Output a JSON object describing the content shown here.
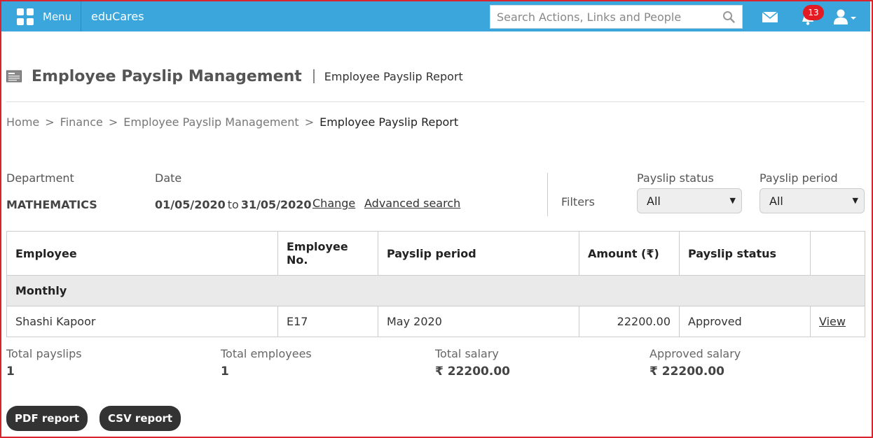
{
  "topbar": {
    "menu_label": "Menu",
    "brand": "eduCares",
    "search_placeholder": "Search Actions, Links and People",
    "notification_count": "13",
    "accent_color": "#3aa6dc"
  },
  "header": {
    "title": "Employee Payslip Management",
    "subtitle": "Employee Payslip Report"
  },
  "breadcrumb": {
    "items": [
      "Home",
      "Finance",
      "Employee Payslip Management"
    ],
    "current": "Employee Payslip Report",
    "separator": ">"
  },
  "criteria": {
    "department_label": "Department",
    "department_value": "MATHEMATICS",
    "date_label": "Date",
    "date_from": "01/05/2020",
    "date_to_word": "to",
    "date_to": "31/05/2020",
    "change_link": "Change",
    "advanced_link": "Advanced search"
  },
  "filters": {
    "label": "Filters",
    "payslip_status_label": "Payslip status",
    "payslip_status_value": "All",
    "payslip_period_label": "Payslip period",
    "payslip_period_value": "All"
  },
  "table": {
    "columns": [
      "Employee",
      "Employee No.",
      "Payslip period",
      "Amount (₹)",
      "Payslip status",
      ""
    ],
    "group": "Monthly",
    "rows": [
      {
        "employee": "Shashi Kapoor",
        "employee_no": "E17",
        "period": "May 2020",
        "amount": "22200.00",
        "status": "Approved",
        "action": "View"
      }
    ]
  },
  "summary": {
    "total_payslips_label": "Total payslips",
    "total_payslips": "1",
    "total_employees_label": "Total employees",
    "total_employees": "1",
    "total_salary_label": "Total salary",
    "total_salary": "₹ 22200.00",
    "approved_salary_label": "Approved salary",
    "approved_salary": "₹ 22200.00"
  },
  "actions": {
    "pdf_label": "PDF report",
    "csv_label": "CSV report"
  },
  "icons": [
    "grid-menu-icon",
    "search-icon",
    "mail-icon",
    "bell-icon",
    "user-icon",
    "payslip-icon"
  ]
}
